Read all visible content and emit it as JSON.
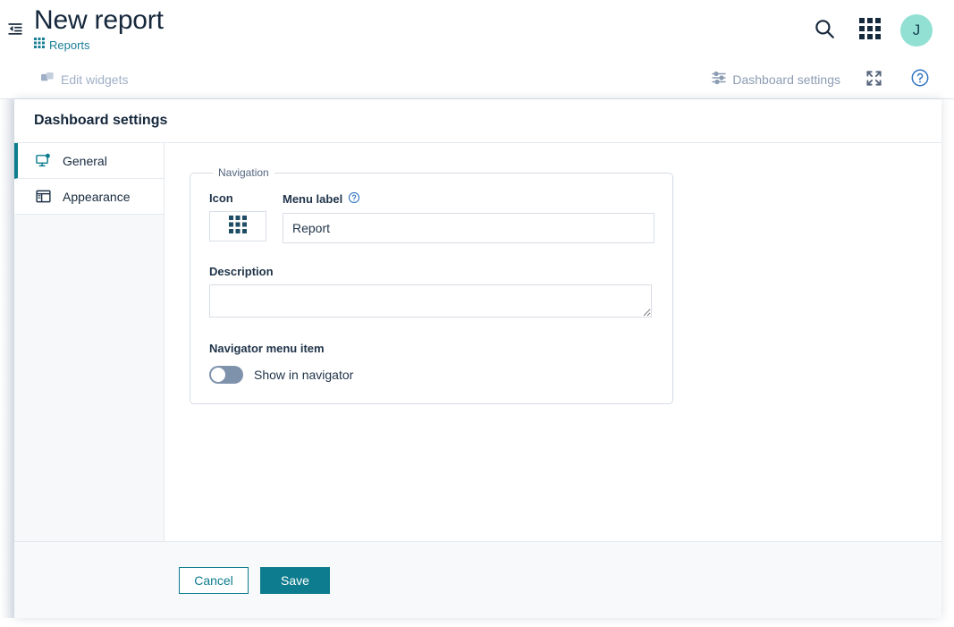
{
  "header": {
    "nav_toggle_icon": "menu-indent-decrease-icon",
    "title": "New report",
    "breadcrumb": {
      "icon": "apps-grid-icon",
      "label": "Reports"
    },
    "search_icon": "search-icon",
    "apps_icon": "apps-grid-icon",
    "avatar_initial": "J"
  },
  "toolbar": {
    "edit_widgets": {
      "icon": "widgets-icon",
      "label": "Edit widgets",
      "state": "disabled"
    },
    "dashboard_settings": {
      "icon": "tune-sliders-icon",
      "label": "Dashboard settings"
    },
    "fullscreen_icon": "fullscreen-expand-icon",
    "help_icon": "help-circle-icon"
  },
  "dialog": {
    "title": "Dashboard settings",
    "nav": {
      "items": [
        {
          "label": "General",
          "icon": "monitor-settings-icon",
          "active": true
        },
        {
          "label": "Appearance",
          "icon": "layout-window-icon",
          "active": false
        }
      ]
    },
    "general": {
      "fieldset_legend": "Navigation",
      "icon_label": "Icon",
      "icon_value": "apps-grid-icon",
      "menu_label_label": "Menu label",
      "menu_label_help_icon": "help-circle-icon",
      "menu_label_value": "Report",
      "menu_label_placeholder": "",
      "description_label": "Description",
      "description_value": "",
      "description_placeholder": "",
      "navigator_menu_item_label": "Navigator menu item",
      "show_in_navigator_label": "Show in navigator",
      "show_in_navigator_on": false
    },
    "footer": {
      "cancel_label": "Cancel",
      "save_label": "Save"
    }
  },
  "colors": {
    "accent_teal": "#0d7c8e",
    "link_teal": "#1a7f96",
    "avatar_bg": "#92e0d3",
    "text_dark": "#16283c",
    "help_blue": "#2f72c4",
    "toggle_off": "#7f92ac"
  }
}
